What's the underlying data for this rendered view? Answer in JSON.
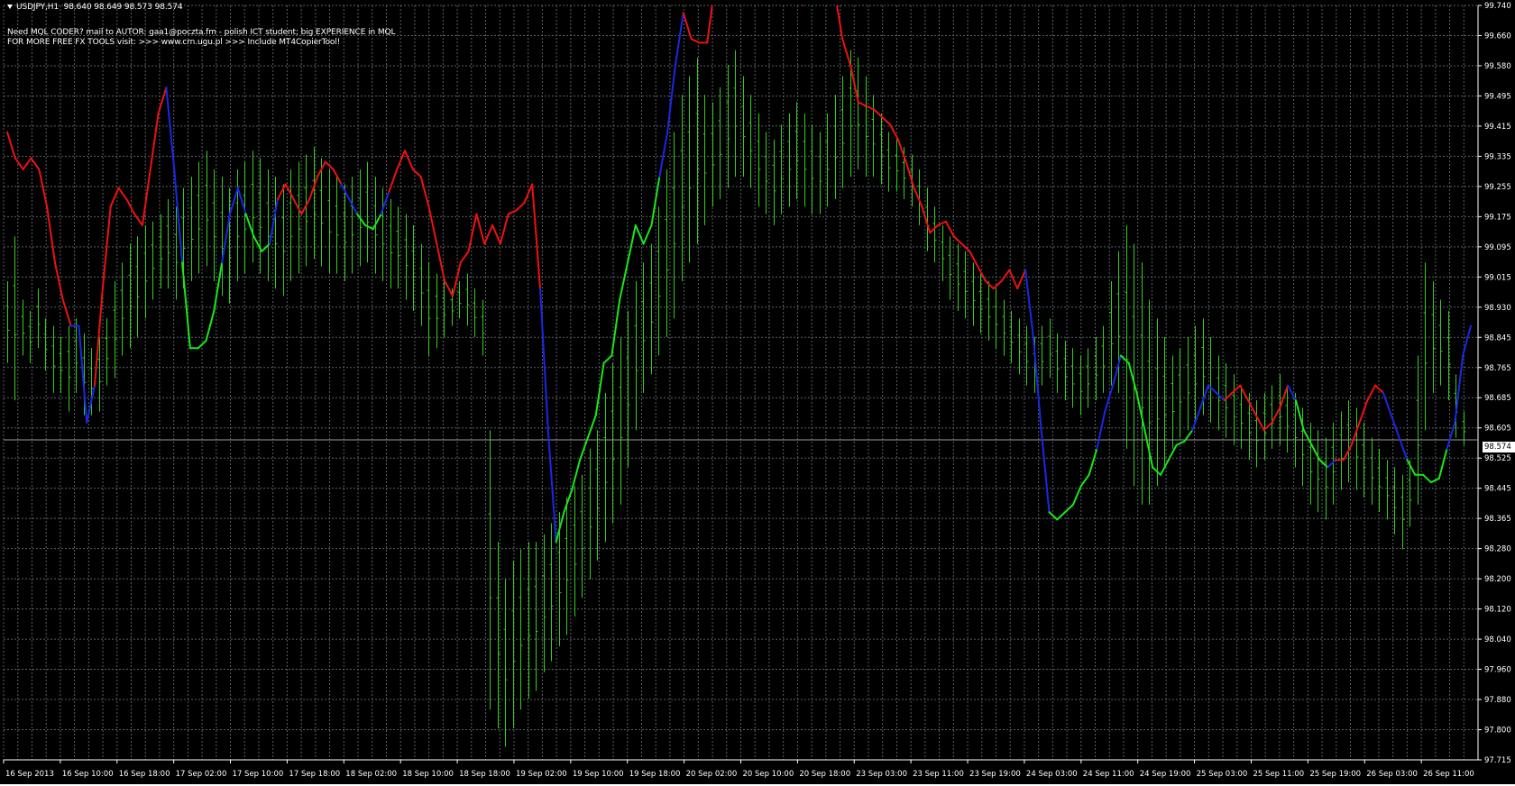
{
  "header": {
    "symbol": "USDJPY,H1",
    "ohlc": "98.640 98.649 98.573 98.574",
    "note_line_1": "Need MQL CODER? mail to AUTOR: gaa1@poczta.fm - polish ICT student; big EXPERIENCE in MQL",
    "note_line_2": "FOR MORE FREE FX TOOLS visit: >>> www.crn.ugu.pl >>> Include MT4CopierTool!"
  },
  "current_price": {
    "label": "98.574",
    "value": 98.574
  },
  "colors": {
    "background": "#000000",
    "grid": "#5a6065",
    "axis_text": "#ffffff",
    "bars": "#32d018",
    "line_up": "#18e818",
    "line_down": "#ee1111",
    "line_neutral": "#1a28e6"
  },
  "chart_data": {
    "type": "line",
    "instrument": "USDJPY",
    "timeframe": "H1",
    "ylim": [
      97.715,
      99.74
    ],
    "price_ticks": [
      "99.740",
      "99.660",
      "99.580",
      "99.495",
      "99.415",
      "99.335",
      "99.255",
      "99.175",
      "99.095",
      "99.015",
      "98.930",
      "98.845",
      "98.765",
      "98.685",
      "98.605",
      "98.525",
      "98.445",
      "98.365",
      "98.280",
      "98.200",
      "98.120",
      "98.040",
      "97.960",
      "97.880",
      "97.800",
      "97.715"
    ],
    "time_ticks": [
      "16 Sep 2013",
      "16 Sep 10:00",
      "16 Sep 18:00",
      "17 Sep 02:00",
      "17 Sep 10:00",
      "17 Sep 18:00",
      "18 Sep 02:00",
      "18 Sep 10:00",
      "18 Sep 18:00",
      "19 Sep 02:00",
      "19 Sep 10:00",
      "19 Sep 18:00",
      "20 Sep 02:00",
      "20 Sep 10:00",
      "20 Sep 18:00",
      "23 Sep 03:00",
      "23 Sep 11:00",
      "23 Sep 19:00",
      "24 Sep 03:00",
      "24 Sep 11:00",
      "24 Sep 19:00",
      "25 Sep 03:00",
      "25 Sep 11:00",
      "25 Sep 19:00",
      "26 Sep 03:00",
      "26 Sep 11:00"
    ],
    "bars": [
      [
        99.0,
        98.78
      ],
      [
        99.12,
        98.68
      ],
      [
        98.95,
        98.8
      ],
      [
        98.92,
        98.78
      ],
      [
        98.98,
        98.82
      ],
      [
        98.9,
        98.76
      ],
      [
        98.88,
        98.7
      ],
      [
        98.85,
        98.7
      ],
      [
        98.88,
        98.65
      ],
      [
        98.9,
        98.7
      ],
      [
        98.86,
        98.64
      ],
      [
        98.82,
        98.64
      ],
      [
        98.85,
        98.65
      ],
      [
        98.9,
        98.72
      ],
      [
        99.0,
        98.74
      ],
      [
        99.05,
        98.8
      ],
      [
        99.1,
        98.82
      ],
      [
        99.12,
        98.85
      ],
      [
        99.15,
        98.9
      ],
      [
        99.16,
        98.95
      ],
      [
        99.18,
        98.98
      ],
      [
        99.22,
        98.98
      ],
      [
        99.2,
        98.95
      ],
      [
        99.25,
        98.98
      ],
      [
        99.28,
        99.0
      ],
      [
        99.32,
        99.02
      ],
      [
        99.35,
        99.04
      ],
      [
        99.3,
        99.0
      ],
      [
        99.28,
        98.96
      ],
      [
        99.25,
        98.94
      ],
      [
        99.3,
        99.0
      ],
      [
        99.32,
        99.02
      ],
      [
        99.35,
        99.05
      ],
      [
        99.33,
        99.02
      ],
      [
        99.3,
        99.0
      ],
      [
        99.28,
        98.98
      ],
      [
        99.26,
        98.96
      ],
      [
        99.3,
        99.0
      ],
      [
        99.32,
        99.02
      ],
      [
        99.34,
        99.04
      ],
      [
        99.36,
        99.06
      ],
      [
        99.33,
        99.04
      ],
      [
        99.3,
        99.02
      ],
      [
        99.28,
        99.02
      ],
      [
        99.26,
        99.0
      ],
      [
        99.28,
        99.02
      ],
      [
        99.3,
        99.04
      ],
      [
        99.32,
        99.05
      ],
      [
        99.28,
        99.02
      ],
      [
        99.25,
        99.0
      ],
      [
        99.22,
        98.98
      ],
      [
        99.2,
        98.98
      ],
      [
        99.18,
        98.95
      ],
      [
        99.15,
        98.92
      ],
      [
        99.1,
        98.88
      ],
      [
        99.05,
        98.8
      ],
      [
        99.02,
        98.82
      ],
      [
        99.0,
        98.85
      ],
      [
        98.98,
        98.88
      ],
      [
        99.0,
        98.9
      ],
      [
        99.02,
        98.88
      ],
      [
        98.98,
        98.85
      ],
      [
        98.95,
        98.8
      ],
      [
        98.6,
        97.85
      ],
      [
        98.3,
        97.8
      ],
      [
        98.2,
        97.75
      ],
      [
        98.25,
        97.8
      ],
      [
        98.28,
        97.85
      ],
      [
        98.3,
        97.88
      ],
      [
        98.3,
        97.9
      ],
      [
        98.32,
        97.95
      ],
      [
        98.35,
        97.98
      ],
      [
        98.38,
        98.02
      ],
      [
        98.42,
        98.05
      ],
      [
        98.45,
        98.1
      ],
      [
        98.48,
        98.15
      ],
      [
        98.55,
        98.2
      ],
      [
        98.6,
        98.25
      ],
      [
        98.7,
        98.3
      ],
      [
        98.78,
        98.35
      ],
      [
        98.85,
        98.4
      ],
      [
        98.92,
        98.5
      ],
      [
        99.0,
        98.6
      ],
      [
        99.05,
        98.7
      ],
      [
        99.1,
        98.75
      ],
      [
        99.2,
        98.8
      ],
      [
        99.3,
        98.85
      ],
      [
        99.4,
        98.9
      ],
      [
        99.5,
        99.0
      ],
      [
        99.55,
        99.05
      ],
      [
        99.6,
        99.1
      ],
      [
        99.5,
        99.15
      ],
      [
        99.48,
        99.2
      ],
      [
        99.52,
        99.22
      ],
      [
        99.58,
        99.25
      ],
      [
        99.62,
        99.28
      ],
      [
        99.55,
        99.28
      ],
      [
        99.5,
        99.25
      ],
      [
        99.45,
        99.2
      ],
      [
        99.4,
        99.18
      ],
      [
        99.38,
        99.15
      ],
      [
        99.42,
        99.18
      ],
      [
        99.45,
        99.2
      ],
      [
        99.48,
        99.22
      ],
      [
        99.45,
        99.2
      ],
      [
        99.42,
        99.18
      ],
      [
        99.4,
        99.18
      ],
      [
        99.45,
        99.2
      ],
      [
        99.5,
        99.22
      ],
      [
        99.55,
        99.25
      ],
      [
        99.62,
        99.28
      ],
      [
        99.6,
        99.3
      ],
      [
        99.55,
        99.28
      ],
      [
        99.5,
        99.28
      ],
      [
        99.45,
        99.26
      ],
      [
        99.4,
        99.24
      ],
      [
        99.38,
        99.24
      ],
      [
        99.36,
        99.22
      ],
      [
        99.34,
        99.2
      ],
      [
        99.3,
        99.15
      ],
      [
        99.25,
        99.08
      ],
      [
        99.2,
        99.05
      ],
      [
        99.15,
        99.0
      ],
      [
        99.12,
        98.95
      ],
      [
        99.1,
        98.92
      ],
      [
        99.08,
        98.9
      ],
      [
        99.05,
        98.88
      ],
      [
        99.02,
        98.86
      ],
      [
        99.0,
        98.84
      ],
      [
        98.98,
        98.82
      ],
      [
        98.95,
        98.8
      ],
      [
        98.92,
        98.78
      ],
      [
        98.9,
        98.75
      ],
      [
        98.88,
        98.72
      ],
      [
        98.85,
        98.7
      ],
      [
        98.88,
        98.72
      ],
      [
        98.9,
        98.74
      ],
      [
        98.86,
        98.7
      ],
      [
        98.84,
        98.68
      ],
      [
        98.82,
        98.66
      ],
      [
        98.8,
        98.64
      ],
      [
        98.82,
        98.66
      ],
      [
        98.85,
        98.68
      ],
      [
        98.88,
        98.7
      ],
      [
        99.0,
        98.72
      ],
      [
        99.08,
        98.7
      ],
      [
        99.15,
        98.55
      ],
      [
        99.1,
        98.45
      ],
      [
        99.05,
        98.4
      ],
      [
        98.95,
        98.4
      ],
      [
        98.9,
        98.45
      ],
      [
        98.85,
        98.5
      ],
      [
        98.8,
        98.55
      ],
      [
        98.82,
        98.58
      ],
      [
        98.85,
        98.6
      ],
      [
        98.88,
        98.62
      ],
      [
        98.9,
        98.64
      ],
      [
        98.85,
        98.62
      ],
      [
        98.8,
        98.6
      ],
      [
        98.78,
        98.58
      ],
      [
        98.75,
        98.56
      ],
      [
        98.72,
        98.55
      ],
      [
        98.7,
        98.52
      ],
      [
        98.68,
        98.5
      ],
      [
        98.7,
        98.52
      ],
      [
        98.72,
        98.55
      ],
      [
        98.75,
        98.56
      ],
      [
        98.72,
        98.54
      ],
      [
        98.7,
        98.5
      ],
      [
        98.66,
        98.45
      ],
      [
        98.62,
        98.4
      ],
      [
        98.6,
        98.38
      ],
      [
        98.58,
        98.36
      ],
      [
        98.62,
        98.4
      ],
      [
        98.65,
        98.44
      ],
      [
        98.68,
        98.46
      ],
      [
        98.66,
        98.44
      ],
      [
        98.62,
        98.42
      ],
      [
        98.58,
        98.4
      ],
      [
        98.55,
        98.38
      ],
      [
        98.52,
        98.36
      ],
      [
        98.5,
        98.32
      ],
      [
        98.48,
        98.28
      ],
      [
        98.52,
        98.34
      ],
      [
        98.8,
        98.4
      ],
      [
        99.05,
        98.6
      ],
      [
        99.0,
        98.7
      ],
      [
        98.95,
        98.72
      ],
      [
        98.92,
        98.68
      ],
      [
        98.75,
        98.58
      ],
      [
        98.65,
        98.56
      ]
    ],
    "line": [
      [
        99.4,
        "r"
      ],
      [
        99.33,
        "r"
      ],
      [
        99.3,
        "r"
      ],
      [
        99.33,
        "r"
      ],
      [
        99.3,
        "r"
      ],
      [
        99.2,
        "r"
      ],
      [
        99.05,
        "r"
      ],
      [
        98.95,
        "r"
      ],
      [
        98.88,
        "r"
      ],
      [
        98.88,
        "b"
      ],
      [
        98.62,
        "b"
      ],
      [
        98.72,
        "b"
      ],
      [
        98.98,
        "r"
      ],
      [
        99.2,
        "r"
      ],
      [
        99.25,
        "r"
      ],
      [
        99.22,
        "r"
      ],
      [
        99.18,
        "r"
      ],
      [
        99.15,
        "r"
      ],
      [
        99.3,
        "r"
      ],
      [
        99.45,
        "r"
      ],
      [
        99.52,
        "r"
      ],
      [
        99.3,
        "b"
      ],
      [
        99.05,
        "b"
      ],
      [
        98.82,
        "g"
      ],
      [
        98.82,
        "g"
      ],
      [
        98.84,
        "g"
      ],
      [
        98.92,
        "g"
      ],
      [
        99.05,
        "g"
      ],
      [
        99.18,
        "b"
      ],
      [
        99.25,
        "b"
      ],
      [
        99.18,
        "b"
      ],
      [
        99.12,
        "g"
      ],
      [
        99.08,
        "g"
      ],
      [
        99.1,
        "g"
      ],
      [
        99.22,
        "b"
      ],
      [
        99.26,
        "r"
      ],
      [
        99.22,
        "r"
      ],
      [
        99.18,
        "r"
      ],
      [
        99.22,
        "r"
      ],
      [
        99.28,
        "r"
      ],
      [
        99.32,
        "r"
      ],
      [
        99.3,
        "r"
      ],
      [
        99.26,
        "r"
      ],
      [
        99.22,
        "b"
      ],
      [
        99.18,
        "b"
      ],
      [
        99.15,
        "g"
      ],
      [
        99.14,
        "g"
      ],
      [
        99.18,
        "g"
      ],
      [
        99.24,
        "b"
      ],
      [
        99.3,
        "r"
      ],
      [
        99.35,
        "r"
      ],
      [
        99.3,
        "r"
      ],
      [
        99.28,
        "r"
      ],
      [
        99.2,
        "r"
      ],
      [
        99.1,
        "r"
      ],
      [
        99.0,
        "r"
      ],
      [
        98.96,
        "r"
      ],
      [
        99.05,
        "r"
      ],
      [
        99.08,
        "r"
      ],
      [
        99.18,
        "r"
      ],
      [
        99.1,
        "r"
      ],
      [
        99.15,
        "r"
      ],
      [
        99.1,
        "r"
      ],
      [
        99.18,
        "r"
      ],
      [
        99.19,
        "r"
      ],
      [
        99.21,
        "r"
      ],
      [
        99.26,
        "r"
      ],
      [
        98.98,
        "r"
      ],
      [
        98.6,
        "b"
      ],
      [
        98.3,
        "b"
      ],
      [
        98.38,
        "g"
      ],
      [
        98.44,
        "g"
      ],
      [
        98.52,
        "g"
      ],
      [
        98.58,
        "g"
      ],
      [
        98.64,
        "g"
      ],
      [
        98.78,
        "g"
      ],
      [
        98.8,
        "g"
      ],
      [
        98.95,
        "g"
      ],
      [
        99.05,
        "g"
      ],
      [
        99.15,
        "g"
      ],
      [
        99.1,
        "g"
      ],
      [
        99.15,
        "g"
      ],
      [
        99.28,
        "g"
      ],
      [
        99.4,
        "b"
      ],
      [
        99.58,
        "b"
      ],
      [
        99.72,
        "b"
      ],
      [
        99.65,
        "r"
      ],
      [
        99.64,
        "r"
      ],
      [
        99.64,
        "r"
      ],
      [
        99.8,
        "r"
      ],
      [
        99.85,
        "r"
      ],
      [
        99.9,
        "r"
      ],
      [
        99.9,
        "r"
      ],
      [
        99.85,
        "r"
      ],
      [
        99.8,
        "r"
      ],
      [
        99.78,
        "r"
      ],
      [
        99.76,
        "r"
      ],
      [
        99.8,
        "r"
      ],
      [
        99.82,
        "r"
      ],
      [
        99.78,
        "r"
      ],
      [
        99.74,
        "r"
      ],
      [
        99.76,
        "r"
      ],
      [
        99.8,
        "r"
      ],
      [
        99.82,
        "r"
      ],
      [
        99.78,
        "r"
      ],
      [
        99.65,
        "r"
      ],
      [
        99.58,
        "r"
      ],
      [
        99.48,
        "r"
      ],
      [
        99.47,
        "r"
      ],
      [
        99.46,
        "r"
      ],
      [
        99.44,
        "r"
      ],
      [
        99.42,
        "r"
      ],
      [
        99.38,
        "r"
      ],
      [
        99.32,
        "r"
      ],
      [
        99.25,
        "r"
      ],
      [
        99.2,
        "r"
      ],
      [
        99.13,
        "r"
      ],
      [
        99.15,
        "r"
      ],
      [
        99.16,
        "r"
      ],
      [
        99.12,
        "r"
      ],
      [
        99.1,
        "r"
      ],
      [
        99.08,
        "r"
      ],
      [
        99.04,
        "r"
      ],
      [
        99.0,
        "r"
      ],
      [
        98.98,
        "r"
      ],
      [
        99.0,
        "r"
      ],
      [
        99.03,
        "r"
      ],
      [
        98.98,
        "r"
      ],
      [
        99.03,
        "r"
      ],
      [
        98.85,
        "b"
      ],
      [
        98.6,
        "b"
      ],
      [
        98.38,
        "b"
      ],
      [
        98.36,
        "g"
      ],
      [
        98.38,
        "g"
      ],
      [
        98.4,
        "g"
      ],
      [
        98.45,
        "g"
      ],
      [
        98.48,
        "g"
      ],
      [
        98.55,
        "g"
      ],
      [
        98.65,
        "b"
      ],
      [
        98.72,
        "b"
      ],
      [
        98.8,
        "b"
      ],
      [
        98.78,
        "g"
      ],
      [
        98.7,
        "g"
      ],
      [
        98.6,
        "g"
      ],
      [
        98.5,
        "g"
      ],
      [
        98.48,
        "g"
      ],
      [
        98.52,
        "g"
      ],
      [
        98.56,
        "g"
      ],
      [
        98.57,
        "g"
      ],
      [
        98.6,
        "g"
      ],
      [
        98.66,
        "b"
      ],
      [
        98.72,
        "b"
      ],
      [
        98.7,
        "b"
      ],
      [
        98.68,
        "b"
      ],
      [
        98.7,
        "r"
      ],
      [
        98.72,
        "r"
      ],
      [
        98.68,
        "r"
      ],
      [
        98.64,
        "r"
      ],
      [
        98.6,
        "r"
      ],
      [
        98.62,
        "r"
      ],
      [
        98.66,
        "r"
      ],
      [
        98.72,
        "r"
      ],
      [
        98.68,
        "b"
      ],
      [
        98.6,
        "g"
      ],
      [
        98.56,
        "g"
      ],
      [
        98.52,
        "g"
      ],
      [
        98.5,
        "g"
      ],
      [
        98.52,
        "b"
      ],
      [
        98.52,
        "r"
      ],
      [
        98.56,
        "r"
      ],
      [
        98.62,
        "r"
      ],
      [
        98.68,
        "r"
      ],
      [
        98.72,
        "r"
      ],
      [
        98.7,
        "r"
      ],
      [
        98.64,
        "b"
      ],
      [
        98.58,
        "b"
      ],
      [
        98.52,
        "b"
      ],
      [
        98.48,
        "g"
      ],
      [
        98.48,
        "g"
      ],
      [
        98.46,
        "g"
      ],
      [
        98.47,
        "g"
      ],
      [
        98.55,
        "g"
      ],
      [
        98.62,
        "b"
      ],
      [
        98.8,
        "b"
      ],
      [
        98.88,
        "b"
      ]
    ]
  }
}
